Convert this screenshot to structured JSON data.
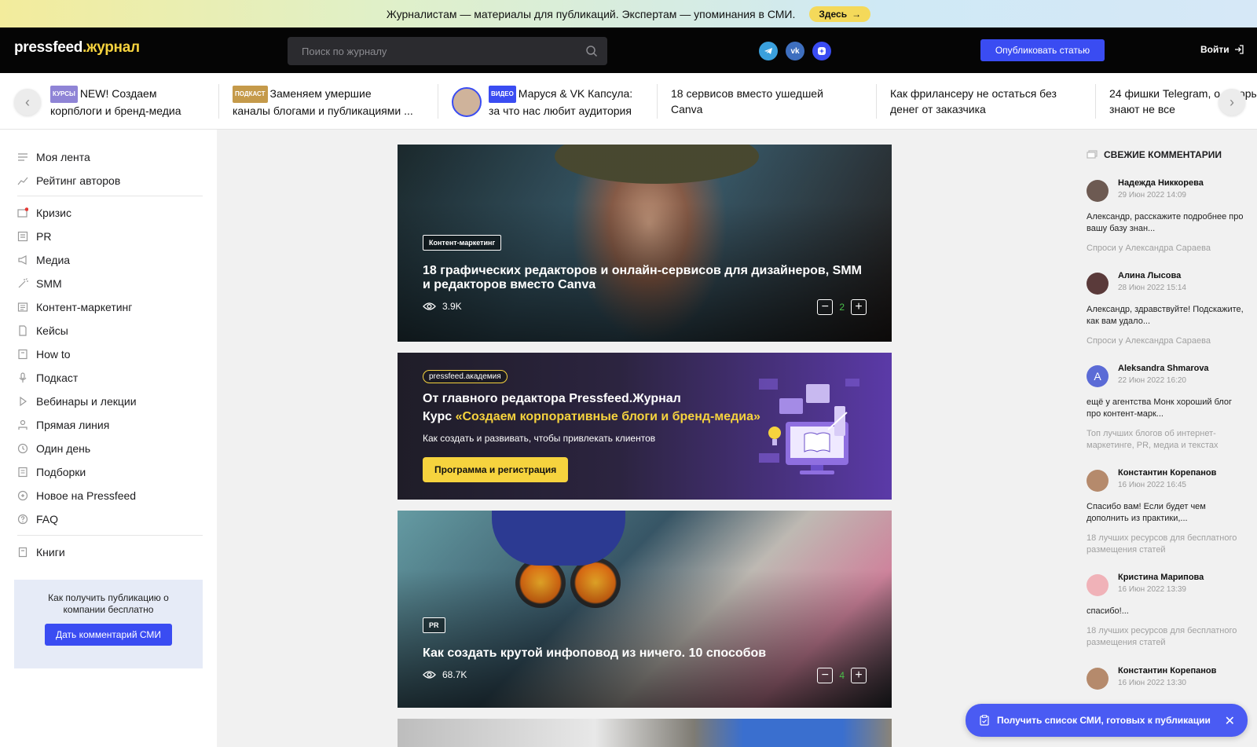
{
  "promo_banner": {
    "text": "Журналистам — материалы для публикаций. Экспертам — упоминания в СМИ.",
    "button_label": "Здесь"
  },
  "header": {
    "logo_main": "pressfeed",
    "logo_accent": ".журнал",
    "search_placeholder": "Поиск по журналу",
    "publish_label": "Опубликовать статью",
    "login_label": "Войти",
    "social_icons": [
      "telegram-icon",
      "vk-icon",
      "dzen-icon"
    ]
  },
  "strip": {
    "items": [
      {
        "tag": "КУРСЫ",
        "tag_color": "#8f84d6",
        "line1": "NEW! Создаем",
        "line2": "корпблоги и бренд-медиа"
      },
      {
        "tag": "ПОДКАСТ",
        "tag_color": "#c59a4a",
        "line1": "Заменяем умершие",
        "line2": "каналы блогами и публикациями ..."
      },
      {
        "tag": "ВИДЕО",
        "tag_color": "#3a4cf2",
        "line1": "Маруся & VK Капсула:",
        "line2": "за что нас любит аудитория"
      },
      {
        "tag": "",
        "line1": "18 сервисов вместо ушедшей",
        "line2": "Canva"
      },
      {
        "tag": "",
        "line1": "Как фрилансеру не остаться без",
        "line2": "денег от заказчика"
      },
      {
        "tag": "",
        "line1": "24 фишки Telegram, о которых",
        "line2": "знают не все"
      }
    ]
  },
  "sidebar": {
    "group1": [
      "Моя лента",
      "Рейтинг авторов"
    ],
    "group2": [
      "Кризис",
      "PR",
      "Медиа",
      "SMM",
      "Контент-маркетинг",
      "Кейсы",
      "How to",
      "Подкаст",
      "Вебинары и лекции",
      "Прямая линия",
      "Один день",
      "Подборки",
      "Новое на Pressfeed",
      "FAQ"
    ],
    "group3": [
      "Книги"
    ],
    "promo_text": "Как получить публикацию о компании бесплатно",
    "promo_button": "Дать комментарий СМИ"
  },
  "cards": [
    {
      "tag": "Контент-маркетинг",
      "title": "18 графических редакторов и онлайн-сервисов для дизайнеров, SMM и редакторов вместо Canva",
      "views": "3.9K",
      "score": "2"
    },
    {
      "tag": "PR",
      "title": "Как создать крутой инфоповод из ничего. 10 способов",
      "views": "68.7K",
      "score": "4"
    }
  ],
  "academy": {
    "pill": "pressfeed.академия",
    "line1": "От главного редактора Pressfeed.Журнал",
    "line2_prefix": "Курс ",
    "line2_accent": "«Создаем корпоративные блоги и бренд-медиа»",
    "subtitle": "Как создать и развивать, чтобы привлекать клиентов",
    "button": "Программа и регистрация"
  },
  "comments": {
    "title": "СВЕЖИЕ КОММЕНТАРИИ",
    "items": [
      {
        "name": "Надежда Никкорева",
        "date": "29 Июн 2022 14:09",
        "text": "Александр, расскажите подробнее про вашу базу знан...",
        "link": "Спроси у Александра Сараева",
        "avatar_color": "#6d5a52"
      },
      {
        "name": "Алина Лысова",
        "date": "28 Июн 2022 15:14",
        "text": "Александр, здравствуйте! Подскажите, как вам удало...",
        "link": "Спроси у Александра Сараева",
        "avatar_color": "#5a3a3a"
      },
      {
        "name": "Aleksandra Shmarova",
        "date": "22 Июн 2022 16:20",
        "text": "ещё у агентства Монк хороший блог про контент-марк...",
        "link": "Топ лучших блогов об интернет-маркетинге, PR, медиа и текстах",
        "avatar_color": "#5b6bd6",
        "avatar_letter": "A"
      },
      {
        "name": "Константин Корепанов",
        "date": "16 Июн 2022 16:45",
        "text": "Спасибо вам! Если будет чем дополнить из практики,...",
        "link": "18 лучших ресурсов для бесплатного размещения статей",
        "avatar_color": "#b58a6c"
      },
      {
        "name": "Кристина Марипова",
        "date": "16 Июн 2022 13:39",
        "text": "спасибо!...",
        "link": "18 лучших ресурсов для бесплатного размещения статей",
        "avatar_color": "#f0b2b8"
      },
      {
        "name": "Константин Корепанов",
        "date": "16 Июн 2022 13:30",
        "text": "",
        "link": "",
        "avatar_color": "#b58a6c"
      }
    ]
  },
  "float_cta": {
    "label": "Получить список СМИ, готовых к публикации"
  }
}
